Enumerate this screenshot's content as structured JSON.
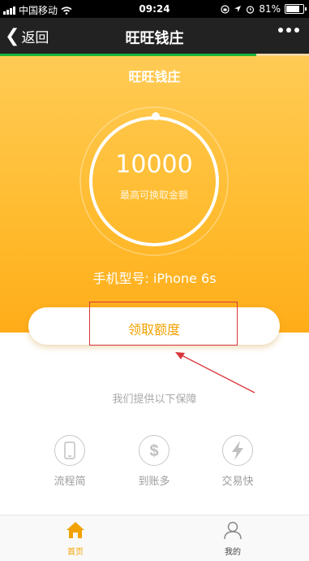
{
  "status_bar": {
    "carrier": "中国移动",
    "time": "09:24",
    "battery": "81%",
    "battery_level": 0.81
  },
  "nav": {
    "back_label": "返回",
    "title": "旺旺钱庄"
  },
  "page_progress": 0.83,
  "hero": {
    "title": "旺旺钱庄",
    "amount": "10000",
    "amount_label": "最高可换取金额",
    "phone_model": "手机型号: iPhone 6s"
  },
  "claim": {
    "label": "领取额度"
  },
  "guarantee": {
    "title": "我们提供以下保障",
    "items": [
      {
        "label": "流程简",
        "icon": "phone-icon"
      },
      {
        "label": "到账多",
        "icon": "dollar-icon"
      },
      {
        "label": "交易快",
        "icon": "lightning-icon"
      }
    ]
  },
  "tabs": [
    {
      "label": "首页",
      "icon": "home-icon",
      "active": true
    },
    {
      "label": "我的",
      "icon": "user-icon",
      "active": false
    }
  ],
  "colors": {
    "accent": "#f2a200",
    "hero": "#ffbb2e",
    "annotation": "#d9363e",
    "progress": "#1db43b"
  }
}
